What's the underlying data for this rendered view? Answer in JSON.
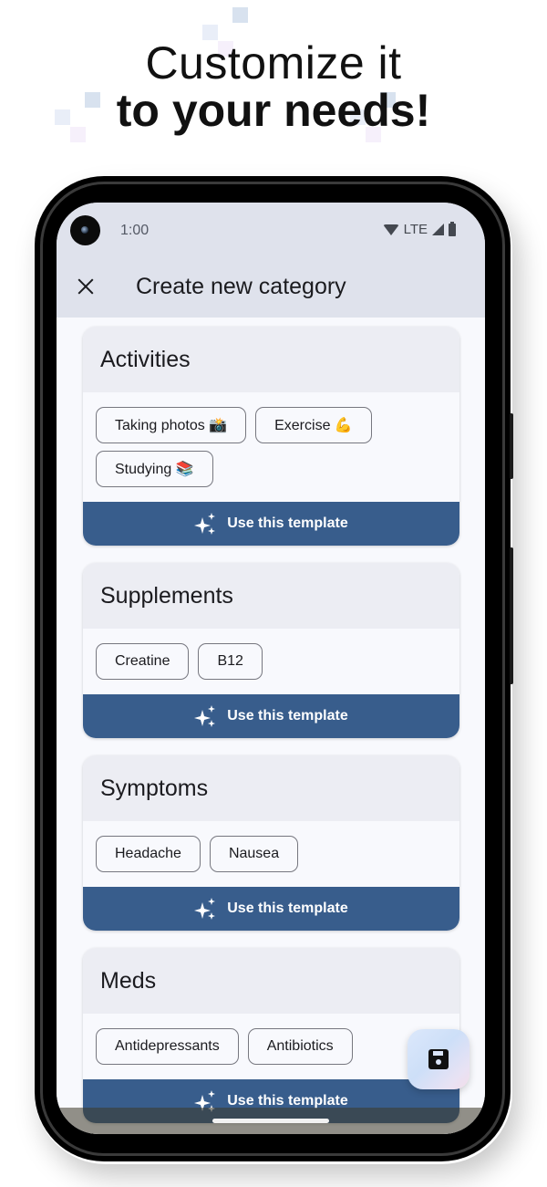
{
  "headline": {
    "line1": "Customize it",
    "line2": "to your needs!"
  },
  "status_bar": {
    "time": "1:00",
    "network": "LTE",
    "icons": [
      "wifi-icon",
      "signal-icon",
      "battery-icon"
    ]
  },
  "app_bar": {
    "close_icon": "close-icon",
    "title": "Create new category"
  },
  "colors": {
    "accent": "#385d8c",
    "app_bar_bg": "#dfe2ec",
    "card_header_bg": "#ecedf3",
    "content_bg": "#f8f9fd"
  },
  "cards": [
    {
      "title": "Activities",
      "chips": [
        "Taking photos 📸",
        "Exercise 💪",
        "Studying 📚"
      ],
      "button_label": "Use this template",
      "button_icon": "sparkle-icon"
    },
    {
      "title": "Supplements",
      "chips": [
        "Creatine",
        "B12"
      ],
      "button_label": "Use this template",
      "button_icon": "sparkle-icon"
    },
    {
      "title": "Symptoms",
      "chips": [
        "Headache",
        "Nausea"
      ],
      "button_label": "Use this template",
      "button_icon": "sparkle-icon"
    },
    {
      "title": "Meds",
      "chips": [
        "Antidepressants",
        "Antibiotics"
      ],
      "button_label": "Use this template",
      "button_icon": "sparkle-icon"
    }
  ],
  "fab": {
    "icon": "save-icon"
  }
}
